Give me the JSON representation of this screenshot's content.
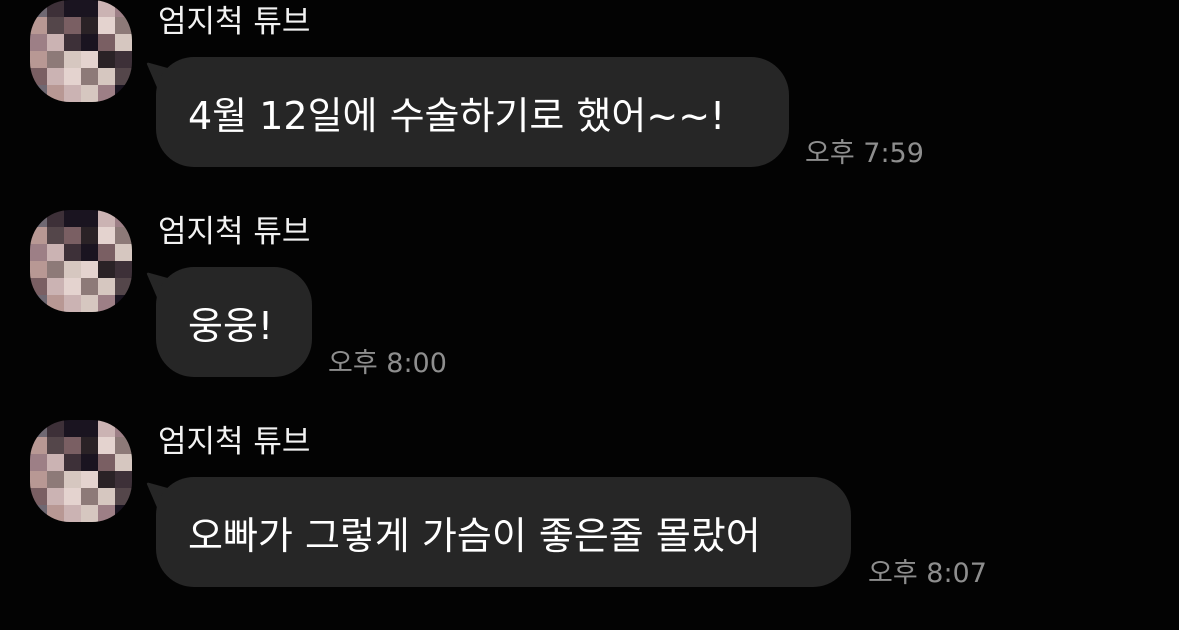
{
  "messages": [
    {
      "sender": "엄지척 튜브",
      "text": "4월 12일에 수술하기로 했어~~!",
      "time": "오후 7:59"
    },
    {
      "sender": "엄지척 튜브",
      "text": "웅웅!",
      "time": "오후 8:00"
    },
    {
      "sender": "엄지척 튜브",
      "text": "오빠가 그렇게 가슴이 좋은줄 몰랐어",
      "time": "오후 8:07"
    }
  ],
  "avatar": {
    "style": "pixelated-profile-photo",
    "palette": [
      "#6f6872",
      "#9d7f86",
      "#3d3038",
      "#1a1420",
      "#cbb3b3",
      "#7a5f63",
      "#b89894",
      "#e4d3cf",
      "#54464a",
      "#8d7a78",
      "#2a2226",
      "#d6c7c0"
    ]
  }
}
